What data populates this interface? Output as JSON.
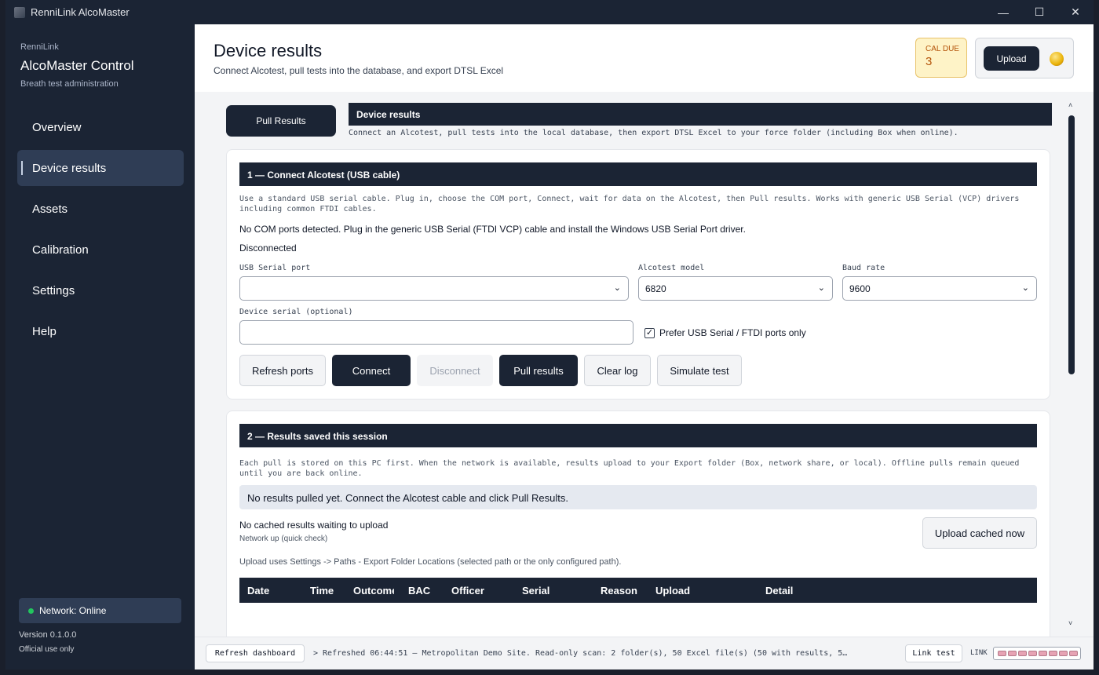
{
  "window": {
    "title": "RenniLink AlcoMaster",
    "min": "—",
    "max": "☐",
    "close": "✕"
  },
  "sidebar": {
    "brand_small": "RenniLink",
    "brand_title": "AlcoMaster Control",
    "brand_sub": "Breath test administration",
    "items": [
      {
        "label": "Overview"
      },
      {
        "label": "Device results"
      },
      {
        "label": "Assets"
      },
      {
        "label": "Calibration"
      },
      {
        "label": "Settings"
      },
      {
        "label": "Help"
      }
    ],
    "network": "Network: Online",
    "version": "Version 0.1.0.0",
    "official": "Official use only"
  },
  "header": {
    "title": "Device results",
    "subtitle": "Connect Alcotest, pull tests into the database, and export DTSL Excel",
    "cal_label": "CAL DUE",
    "cal_value": "3",
    "upload_label": "Upload"
  },
  "top": {
    "pull_button": "Pull Results",
    "panel_title": "Device results",
    "panel_sub": "Connect an Alcotest, pull tests into the local database, then export DTSL Excel to your force folder (including Box when online)."
  },
  "section1": {
    "title": "1 — Connect Alcotest (USB cable)",
    "info": "Use a standard USB serial cable. Plug in, choose the COM port, Connect, wait for data on the Alcotest, then Pull results. Works with generic USB Serial (VCP) drivers including common FTDI cables.",
    "no_ports": "No COM ports detected. Plug in the generic USB Serial (FTDI VCP) cable and install the Windows USB Serial Port driver.",
    "status": "Disconnected",
    "port_label": "USB Serial port",
    "port_value": "",
    "model_label": "Alcotest model",
    "model_value": "6820",
    "baud_label": "Baud rate",
    "baud_value": "9600",
    "serial_label": "Device serial (optional)",
    "serial_value": "",
    "prefer_label": "Prefer USB Serial / FTDI ports only",
    "prefer_checked": "✓",
    "buttons": {
      "refresh": "Refresh ports",
      "connect": "Connect",
      "disconnect": "Disconnect",
      "pull": "Pull results",
      "clear": "Clear log",
      "simulate": "Simulate test"
    }
  },
  "section2": {
    "title": "2 — Results saved this session",
    "info": "Each pull is stored on this PC first. When the network is available, results upload to your Export folder (Box, network share, or local). Offline pulls remain queued until you are back online.",
    "banner": "No results pulled yet. Connect the Alcotest cable and click Pull Results.",
    "cached_title": "No cached results waiting to upload",
    "cached_sub": "Network up (quick check)",
    "upload_cached": "Upload cached now",
    "upload_note": "Upload uses Settings -> Paths  -  Export Folder Locations (selected path or the only configured path).",
    "columns": [
      "Date",
      "Time",
      "Outcome",
      "BAC",
      "Officer",
      "Serial",
      "Reason",
      "Upload",
      "Detail"
    ]
  },
  "statusbar": {
    "refresh": "Refresh dashboard",
    "log": "> Refreshed 06:44:51 — Metropolitan Demo Site. Read-only scan: 2 folder(s), 50 Excel file(s) (50 with results, 5…",
    "link_test": "Link test",
    "link_label": "LINK"
  },
  "colors": {
    "navy": "#1b2434",
    "accent": "#2f3d55",
    "online": "#22c55e",
    "cal_due": "#b45309"
  }
}
